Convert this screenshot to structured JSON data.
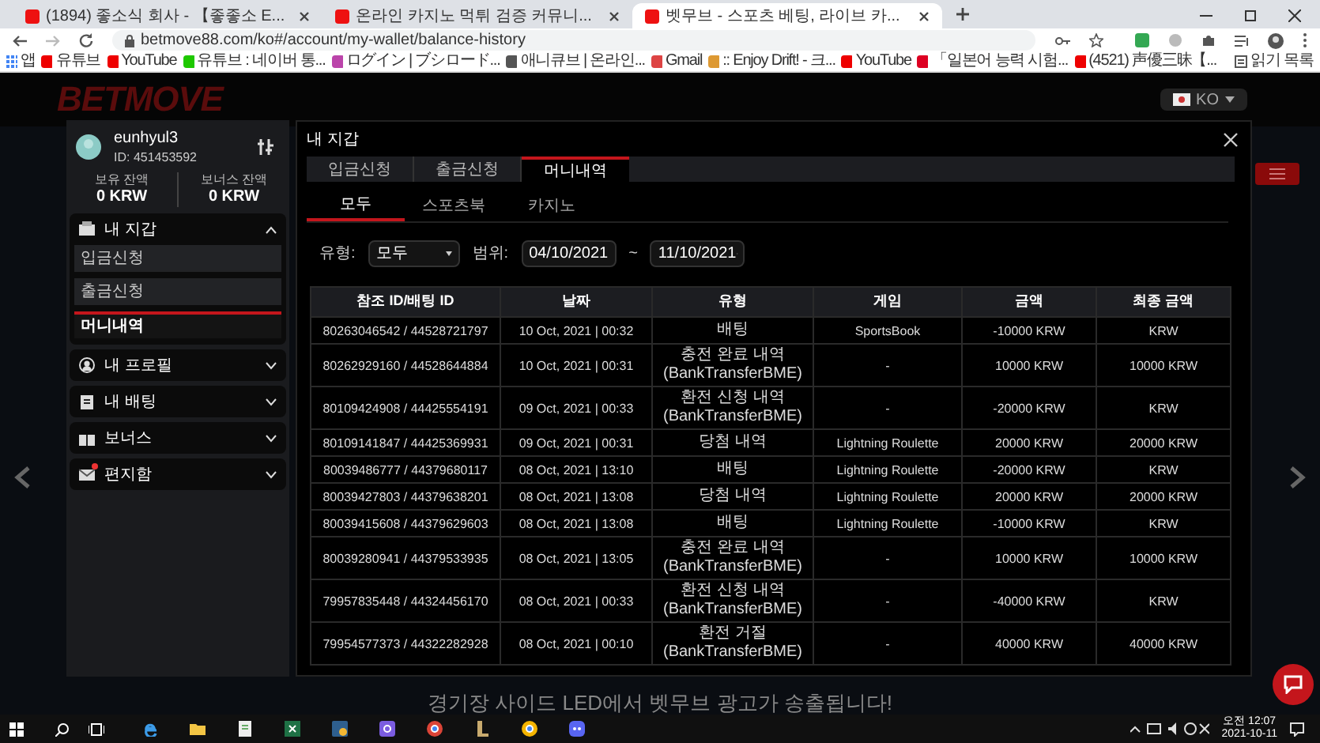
{
  "browser": {
    "tabs": [
      {
        "title": "(1894) 좋소식 회사 - 【좋좋소 E...",
        "selected": false
      },
      {
        "title": "온라인 카지노 먹튀 검증 커뮤니...",
        "selected": false
      },
      {
        "title": "벳무브 - 스포츠 베팅, 라이브 카...",
        "selected": true
      }
    ],
    "url": "betmove88.com/ko#/account/my-wallet/balance-history",
    "bookmarks": [
      "앱",
      "유튜브",
      "YouTube",
      "유튜브 : 네이버 통...",
      "ログイン | ブシロード...",
      "애니큐브 | 온라인...",
      "Gmail",
      ":: Enjoy Drift! - 크...",
      "YouTube",
      "「일본어 능력 시험...",
      "(4521) 声優三昧【..."
    ],
    "reading_list": "읽기 목록"
  },
  "site": {
    "logo": "BETMOVE",
    "language": "KO",
    "banner": "경기장 사이드 LED에서 벳무브 광고가 송출됩니다!"
  },
  "sidebar": {
    "username": "eunhyul3",
    "user_id": "ID: 451453592",
    "balances": [
      {
        "label": "보유 잔액",
        "value": "0 KRW"
      },
      {
        "label": "보너스 잔액",
        "value": "0 KRW"
      }
    ],
    "menu": [
      {
        "kind": "wallet",
        "label": "내 지갑",
        "expanded": true,
        "children": [
          {
            "label": "입금신청",
            "selected": false
          },
          {
            "label": "출금신청",
            "selected": false
          },
          {
            "label": "머니내역",
            "selected": true
          }
        ]
      },
      {
        "kind": "profile",
        "label": "내 프로필",
        "expanded": false
      },
      {
        "kind": "betting",
        "label": "내 배팅",
        "expanded": false
      },
      {
        "kind": "bonus",
        "label": "보너스",
        "expanded": false
      },
      {
        "kind": "mail",
        "label": "편지함",
        "expanded": false,
        "unread": true
      }
    ]
  },
  "wallet": {
    "title": "내 지갑",
    "tabs": [
      {
        "label": "입금신청",
        "selected": false
      },
      {
        "label": "출금신청",
        "selected": false
      },
      {
        "label": "머니내역",
        "selected": true
      }
    ],
    "subtabs": [
      {
        "label": "모두",
        "selected": true
      },
      {
        "label": "스포츠북",
        "selected": false
      },
      {
        "label": "카지노",
        "selected": false
      }
    ],
    "filters": {
      "type_label": "유형:",
      "type_value": "모두",
      "range_label": "범위:",
      "start_date": "04/10/2021",
      "separator": "~",
      "end_date": "11/10/2021"
    },
    "table": {
      "columns": [
        "참조 ID/배팅 ID",
        "날짜",
        "유형",
        "게임",
        "금액",
        "최종 금액"
      ],
      "rows": [
        [
          "80263046542 / 44528721797",
          "10 Oct, 2021 | 00:32",
          "배팅",
          "SportsBook",
          "-10000 KRW",
          "KRW"
        ],
        [
          "80262929160 / 44528644884",
          "10 Oct, 2021 | 00:31",
          "충전 완료 내역 (BankTransferBME)",
          "-",
          "10000 KRW",
          "10000 KRW"
        ],
        [
          "80109424908 / 44425554191",
          "09 Oct, 2021 | 00:33",
          "환전 신청 내역 (BankTransferBME)",
          "-",
          "-20000 KRW",
          "KRW"
        ],
        [
          "80109141847 / 44425369931",
          "09 Oct, 2021 | 00:31",
          "당첨 내역",
          "Lightning Roulette",
          "20000 KRW",
          "20000 KRW"
        ],
        [
          "80039486777 / 44379680117",
          "08 Oct, 2021 | 13:10",
          "배팅",
          "Lightning Roulette",
          "-20000 KRW",
          "KRW"
        ],
        [
          "80039427803 / 44379638201",
          "08 Oct, 2021 | 13:08",
          "당첨 내역",
          "Lightning Roulette",
          "20000 KRW",
          "20000 KRW"
        ],
        [
          "80039415608 / 44379629603",
          "08 Oct, 2021 | 13:08",
          "배팅",
          "Lightning Roulette",
          "-10000 KRW",
          "KRW"
        ],
        [
          "80039280941 / 44379533935",
          "08 Oct, 2021 | 13:05",
          "충전 완료 내역 (BankTransferBME)",
          "-",
          "10000 KRW",
          "10000 KRW"
        ],
        [
          "79957835448 / 44324456170",
          "08 Oct, 2021 | 00:33",
          "환전 신청 내역 (BankTransferBME)",
          "-",
          "-40000 KRW",
          "KRW"
        ],
        [
          "79954577373 / 44322282928",
          "08 Oct, 2021 | 00:10",
          "환전 거절 (BankTransferBME)",
          "-",
          "40000 KRW",
          "40000 KRW"
        ]
      ]
    }
  },
  "taskbar": {
    "time": "오전 12:07",
    "date": "2021-10-11"
  }
}
